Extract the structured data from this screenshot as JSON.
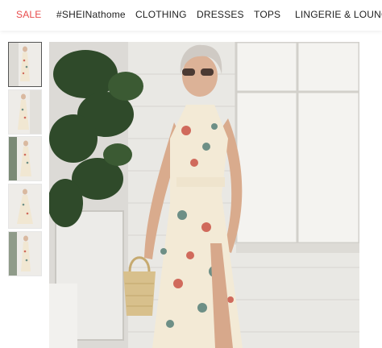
{
  "nav": {
    "items": [
      {
        "label": "SALE"
      },
      {
        "label": "#SHEINathome"
      },
      {
        "label": "CLOTHING"
      },
      {
        "label": "DRESSES"
      },
      {
        "label": "TOPS"
      },
      {
        "label": "LINGERIE & LOUNGE"
      }
    ]
  },
  "gallery": {
    "thumbnail_count": 5,
    "selected_index": 0
  },
  "colors": {
    "sale": "#e84b4b",
    "dress_base": "#f3ead6",
    "wall": "#e9e8e4",
    "plant": "#2f4a2a"
  }
}
